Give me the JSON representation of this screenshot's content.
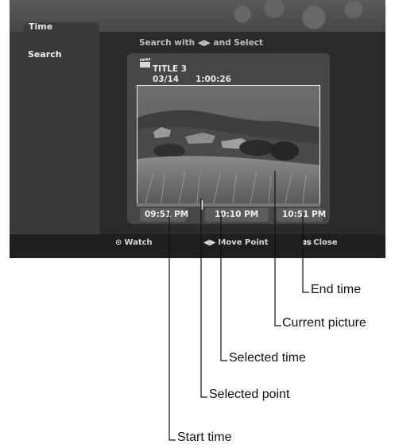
{
  "osd": {
    "title": "Time",
    "menu_item": "Search",
    "instruction": "Search with ◀▶ and Select",
    "recording": {
      "title": "TITLE 3",
      "date": "03/14",
      "duration": "1:00:26"
    },
    "times": {
      "start": "09:51 PM",
      "selected": "10:10 PM",
      "end": "10:51 PM"
    },
    "selected_point_fraction": 0.35,
    "hints": [
      {
        "icon": "⊙",
        "label": "Watch"
      },
      {
        "icon": "◀▶",
        "label": "Move Point"
      },
      {
        "icon": "ടേ",
        "label": "Close"
      }
    ]
  },
  "callouts": {
    "end_time": "End time",
    "current_picture": "Current picture",
    "selected_time": "Selected time",
    "selected_point": "Selected point",
    "start_time": "Start time"
  }
}
